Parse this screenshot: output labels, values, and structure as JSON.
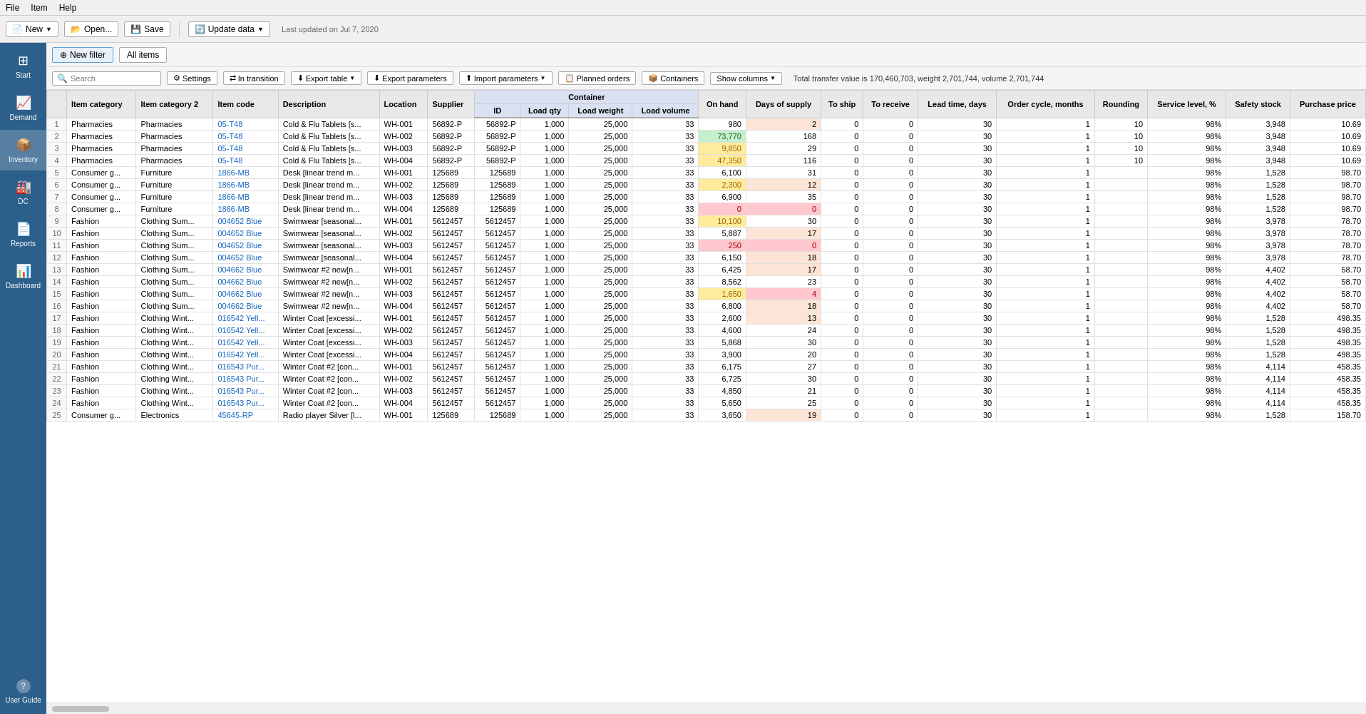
{
  "menu": {
    "items": [
      "File",
      "Item",
      "Help"
    ]
  },
  "toolbar": {
    "new_label": "New",
    "open_label": "Open...",
    "save_label": "Save",
    "update_label": "Update data",
    "last_updated": "Last updated on Jul 7, 2020"
  },
  "sidebar": {
    "items": [
      {
        "id": "start",
        "label": "Start",
        "icon": "⊞"
      },
      {
        "id": "demand",
        "label": "Demand",
        "icon": "📈"
      },
      {
        "id": "inventory",
        "label": "Inventory",
        "icon": "📦"
      },
      {
        "id": "dc",
        "label": "DC",
        "icon": "🏭"
      },
      {
        "id": "reports",
        "label": "Reports",
        "icon": "📄"
      },
      {
        "id": "dashboard",
        "label": "Dashboard",
        "icon": "📊"
      }
    ],
    "bottom": {
      "id": "user-guide",
      "label": "User Guide",
      "icon": "?"
    }
  },
  "filter_bar": {
    "new_filter_label": "New filter",
    "all_items_label": "All items"
  },
  "action_bar": {
    "settings_label": "Settings",
    "in_transition_label": "In transition",
    "export_table_label": "Export table",
    "export_parameters_label": "Export parameters",
    "import_parameters_label": "Import parameters",
    "planned_orders_label": "Planned orders",
    "containers_label": "Containers",
    "show_columns_label": "Show columns",
    "search_placeholder": "Search",
    "total_info": "Total transfer value is 170,460,703, weight 2,701,744, volume 2,701,744"
  },
  "table": {
    "headers": {
      "item_category": "Item category",
      "item_category2": "Item category 2",
      "item_code": "Item code",
      "description": "Description",
      "location": "Location",
      "supplier": "Supplier",
      "container_group": "Container",
      "container_id": "ID",
      "load_qty": "Load qty",
      "load_weight": "Load weight",
      "load_volume": "Load volume",
      "on_hand": "On hand",
      "days_of_supply": "Days of supply",
      "to_ship": "To ship",
      "to_receive": "To receive",
      "lead_time_days": "Lead time, days",
      "order_cycle_months": "Order cycle, months",
      "rounding": "Rounding",
      "service_level": "Service level, %",
      "safety_stock": "Safety stock",
      "purchase_price": "Purchase price"
    },
    "rows": [
      {
        "num": 1,
        "cat1": "Pharmacies",
        "cat2": "Pharmacies",
        "code": "05-T48",
        "desc": "Cold & Flu Tablets [s...",
        "location": "WH-001",
        "supplier": "56892-P",
        "cont_id": "56892-P",
        "load_qty": 1000,
        "load_weight": "25,000",
        "load_volume": 33,
        "on_hand": 980,
        "on_hand_color": "white",
        "days": 2,
        "days_color": "orange",
        "to_ship": 0,
        "to_receive": 0,
        "lead_time": 30,
        "order_cycle": 1,
        "rounding": 10,
        "service_level": "98%",
        "safety_stock": 3948,
        "purchase_price": "10.69"
      },
      {
        "num": 2,
        "cat1": "Pharmacies",
        "cat2": "Pharmacies",
        "code": "05-T48",
        "desc": "Cold & Flu Tablets [s...",
        "location": "WH-002",
        "supplier": "56892-P",
        "cont_id": "56892-P",
        "load_qty": 1000,
        "load_weight": "25,000",
        "load_volume": 33,
        "on_hand": 73770,
        "on_hand_color": "green",
        "days": 168,
        "days_color": "",
        "to_ship": 0,
        "to_receive": 0,
        "lead_time": 30,
        "order_cycle": 1,
        "rounding": 10,
        "service_level": "98%",
        "safety_stock": 3948,
        "purchase_price": "10.69"
      },
      {
        "num": 3,
        "cat1": "Pharmacies",
        "cat2": "Pharmacies",
        "code": "05-T48",
        "desc": "Cold & Flu Tablets [s...",
        "location": "WH-003",
        "supplier": "56892-P",
        "cont_id": "56892-P",
        "load_qty": 1000,
        "load_weight": "25,000",
        "load_volume": 33,
        "on_hand": 9850,
        "on_hand_color": "yellow",
        "days": 29,
        "days_color": "",
        "to_ship": 0,
        "to_receive": 0,
        "lead_time": 30,
        "order_cycle": 1,
        "rounding": 10,
        "service_level": "98%",
        "safety_stock": 3948,
        "purchase_price": "10.69"
      },
      {
        "num": 4,
        "cat1": "Pharmacies",
        "cat2": "Pharmacies",
        "code": "05-T48",
        "desc": "Cold & Flu Tablets [s...",
        "location": "WH-004",
        "supplier": "56892-P",
        "cont_id": "56892-P",
        "load_qty": 1000,
        "load_weight": "25,000",
        "load_volume": 33,
        "on_hand": 47350,
        "on_hand_color": "yellow",
        "days": 116,
        "days_color": "",
        "to_ship": 0,
        "to_receive": 0,
        "lead_time": 30,
        "order_cycle": 1,
        "rounding": 10,
        "service_level": "98%",
        "safety_stock": 3948,
        "purchase_price": "10.69"
      },
      {
        "num": 5,
        "cat1": "Consumer g...",
        "cat2": "Furniture",
        "code": "1866-MB",
        "desc": "Desk [linear trend m...",
        "location": "WH-001",
        "supplier": "125689",
        "cont_id": "125689",
        "load_qty": 1000,
        "load_weight": "25,000",
        "load_volume": 33,
        "on_hand": 6100,
        "on_hand_color": "white",
        "days": 31,
        "days_color": "",
        "to_ship": 0,
        "to_receive": 0,
        "lead_time": 30,
        "order_cycle": 1,
        "rounding": "",
        "service_level": "98%",
        "safety_stock": 1528,
        "purchase_price": "98.70"
      },
      {
        "num": 6,
        "cat1": "Consumer g...",
        "cat2": "Furniture",
        "code": "1866-MB",
        "desc": "Desk [linear trend m...",
        "location": "WH-002",
        "supplier": "125689",
        "cont_id": "125689",
        "load_qty": 1000,
        "load_weight": "25,000",
        "load_volume": 33,
        "on_hand": 2300,
        "on_hand_color": "orange",
        "days": 12,
        "days_color": "orange",
        "to_ship": 0,
        "to_receive": 0,
        "lead_time": 30,
        "order_cycle": 1,
        "rounding": "",
        "service_level": "98%",
        "safety_stock": 1528,
        "purchase_price": "98.70"
      },
      {
        "num": 7,
        "cat1": "Consumer g...",
        "cat2": "Furniture",
        "code": "1866-MB",
        "desc": "Desk [linear trend m...",
        "location": "WH-003",
        "supplier": "125689",
        "cont_id": "125689",
        "load_qty": 1000,
        "load_weight": "25,000",
        "load_volume": 33,
        "on_hand": 6900,
        "on_hand_color": "white",
        "days": 35,
        "days_color": "",
        "to_ship": 0,
        "to_receive": 0,
        "lead_time": 30,
        "order_cycle": 1,
        "rounding": "",
        "service_level": "98%",
        "safety_stock": 1528,
        "purchase_price": "98.70"
      },
      {
        "num": 8,
        "cat1": "Consumer g...",
        "cat2": "Furniture",
        "code": "1866-MB",
        "desc": "Desk [linear trend m...",
        "location": "WH-004",
        "supplier": "125689",
        "cont_id": "125689",
        "load_qty": 1000,
        "load_weight": "25,000",
        "load_volume": 33,
        "on_hand": 0,
        "on_hand_color": "red",
        "days": 0,
        "days_color": "red",
        "to_ship": 0,
        "to_receive": 0,
        "lead_time": 30,
        "order_cycle": 1,
        "rounding": "",
        "service_level": "98%",
        "safety_stock": 1528,
        "purchase_price": "98.70"
      },
      {
        "num": 9,
        "cat1": "Fashion",
        "cat2": "Clothing Sum...",
        "code": "004652 Blue",
        "desc": "Swimwear [seasonal...",
        "location": "WH-001",
        "supplier": "5612457",
        "cont_id": "5612457",
        "load_qty": 1000,
        "load_weight": "25,000",
        "load_volume": 33,
        "on_hand": 10100,
        "on_hand_color": "yellow",
        "days": 30,
        "days_color": "",
        "to_ship": 0,
        "to_receive": 0,
        "lead_time": 30,
        "order_cycle": 1,
        "rounding": "",
        "service_level": "98%",
        "safety_stock": 3978,
        "purchase_price": "78.70"
      },
      {
        "num": 10,
        "cat1": "Fashion",
        "cat2": "Clothing Sum...",
        "code": "004652 Blue",
        "desc": "Swimwear [seasonal...",
        "location": "WH-002",
        "supplier": "5612457",
        "cont_id": "5612457",
        "load_qty": 1000,
        "load_weight": "25,000",
        "load_volume": 33,
        "on_hand": 5887,
        "on_hand_color": "white",
        "days": 17,
        "days_color": "orange",
        "to_ship": 0,
        "to_receive": 0,
        "lead_time": 30,
        "order_cycle": 1,
        "rounding": "",
        "service_level": "98%",
        "safety_stock": 3978,
        "purchase_price": "78.70"
      },
      {
        "num": 11,
        "cat1": "Fashion",
        "cat2": "Clothing Sum...",
        "code": "004652 Blue",
        "desc": "Swimwear [seasonal...",
        "location": "WH-003",
        "supplier": "5612457",
        "cont_id": "5612457",
        "load_qty": 1000,
        "load_weight": "25,000",
        "load_volume": 33,
        "on_hand": 250,
        "on_hand_color": "red",
        "days": 0,
        "days_color": "red",
        "to_ship": 0,
        "to_receive": 0,
        "lead_time": 30,
        "order_cycle": 1,
        "rounding": "",
        "service_level": "98%",
        "safety_stock": 3978,
        "purchase_price": "78.70"
      },
      {
        "num": 12,
        "cat1": "Fashion",
        "cat2": "Clothing Sum...",
        "code": "004652 Blue",
        "desc": "Swimwear [seasonal...",
        "location": "WH-004",
        "supplier": "5612457",
        "cont_id": "5612457",
        "load_qty": 1000,
        "load_weight": "25,000",
        "load_volume": 33,
        "on_hand": 6150,
        "on_hand_color": "white",
        "days": 18,
        "days_color": "orange",
        "to_ship": 0,
        "to_receive": 0,
        "lead_time": 30,
        "order_cycle": 1,
        "rounding": "",
        "service_level": "98%",
        "safety_stock": 3978,
        "purchase_price": "78.70"
      },
      {
        "num": 13,
        "cat1": "Fashion",
        "cat2": "Clothing Sum...",
        "code": "004662 Blue",
        "desc": "Swimwear #2 new[n...",
        "location": "WH-001",
        "supplier": "5612457",
        "cont_id": "5612457",
        "load_qty": 1000,
        "load_weight": "25,000",
        "load_volume": 33,
        "on_hand": 6425,
        "on_hand_color": "white",
        "days": 17,
        "days_color": "orange",
        "to_ship": 0,
        "to_receive": 0,
        "lead_time": 30,
        "order_cycle": 1,
        "rounding": "",
        "service_level": "98%",
        "safety_stock": 4402,
        "purchase_price": "58.70"
      },
      {
        "num": 14,
        "cat1": "Fashion",
        "cat2": "Clothing Sum...",
        "code": "004662 Blue",
        "desc": "Swimwear #2 new[n...",
        "location": "WH-002",
        "supplier": "5612457",
        "cont_id": "5612457",
        "load_qty": 1000,
        "load_weight": "25,000",
        "load_volume": 33,
        "on_hand": 8562,
        "on_hand_color": "white",
        "days": 23,
        "days_color": "",
        "to_ship": 0,
        "to_receive": 0,
        "lead_time": 30,
        "order_cycle": 1,
        "rounding": "",
        "service_level": "98%",
        "safety_stock": 4402,
        "purchase_price": "58.70"
      },
      {
        "num": 15,
        "cat1": "Fashion",
        "cat2": "Clothing Sum...",
        "code": "004662 Blue",
        "desc": "Swimwear #2 new[n...",
        "location": "WH-003",
        "supplier": "5612457",
        "cont_id": "5612457",
        "load_qty": 1000,
        "load_weight": "25,000",
        "load_volume": 33,
        "on_hand": 1650,
        "on_hand_color": "orange",
        "days": 4,
        "days_color": "red",
        "to_ship": 0,
        "to_receive": 0,
        "lead_time": 30,
        "order_cycle": 1,
        "rounding": "",
        "service_level": "98%",
        "safety_stock": 4402,
        "purchase_price": "58.70"
      },
      {
        "num": 16,
        "cat1": "Fashion",
        "cat2": "Clothing Sum...",
        "code": "004662 Blue",
        "desc": "Swimwear #2 new[n...",
        "location": "WH-004",
        "supplier": "5612457",
        "cont_id": "5612457",
        "load_qty": 1000,
        "load_weight": "25,000",
        "load_volume": 33,
        "on_hand": 6800,
        "on_hand_color": "white",
        "days": 18,
        "days_color": "orange",
        "to_ship": 0,
        "to_receive": 0,
        "lead_time": 30,
        "order_cycle": 1,
        "rounding": "",
        "service_level": "98%",
        "safety_stock": 4402,
        "purchase_price": "58.70"
      },
      {
        "num": 17,
        "cat1": "Fashion",
        "cat2": "Clothing Wint...",
        "code": "016542 Yell...",
        "desc": "Winter Coat [excessi...",
        "location": "WH-001",
        "supplier": "5612457",
        "cont_id": "5612457",
        "load_qty": 1000,
        "load_weight": "25,000",
        "load_volume": 33,
        "on_hand": 2600,
        "on_hand_color": "white",
        "days": 13,
        "days_color": "orange",
        "to_ship": 0,
        "to_receive": 0,
        "lead_time": 30,
        "order_cycle": 1,
        "rounding": "",
        "service_level": "98%",
        "safety_stock": 1528,
        "purchase_price": "498.35"
      },
      {
        "num": 18,
        "cat1": "Fashion",
        "cat2": "Clothing Wint...",
        "code": "016542 Yell...",
        "desc": "Winter Coat [excessi...",
        "location": "WH-002",
        "supplier": "5612457",
        "cont_id": "5612457",
        "load_qty": 1000,
        "load_weight": "25,000",
        "load_volume": 33,
        "on_hand": 4600,
        "on_hand_color": "white",
        "days": 24,
        "days_color": "",
        "to_ship": 0,
        "to_receive": 0,
        "lead_time": 30,
        "order_cycle": 1,
        "rounding": "",
        "service_level": "98%",
        "safety_stock": 1528,
        "purchase_price": "498.35"
      },
      {
        "num": 19,
        "cat1": "Fashion",
        "cat2": "Clothing Wint...",
        "code": "016542 Yell...",
        "desc": "Winter Coat [excessi...",
        "location": "WH-003",
        "supplier": "5612457",
        "cont_id": "5612457",
        "load_qty": 1000,
        "load_weight": "25,000",
        "load_volume": 33,
        "on_hand": 5868,
        "on_hand_color": "white",
        "days": 30,
        "days_color": "",
        "to_ship": 0,
        "to_receive": 0,
        "lead_time": 30,
        "order_cycle": 1,
        "rounding": "",
        "service_level": "98%",
        "safety_stock": 1528,
        "purchase_price": "498.35"
      },
      {
        "num": 20,
        "cat1": "Fashion",
        "cat2": "Clothing Wint...",
        "code": "016542 Yell...",
        "desc": "Winter Coat [excessi...",
        "location": "WH-004",
        "supplier": "5612457",
        "cont_id": "5612457",
        "load_qty": 1000,
        "load_weight": "25,000",
        "load_volume": 33,
        "on_hand": 3900,
        "on_hand_color": "white",
        "days": 20,
        "days_color": "",
        "to_ship": 0,
        "to_receive": 0,
        "lead_time": 30,
        "order_cycle": 1,
        "rounding": "",
        "service_level": "98%",
        "safety_stock": 1528,
        "purchase_price": "498.35"
      },
      {
        "num": 21,
        "cat1": "Fashion",
        "cat2": "Clothing Wint...",
        "code": "016543 Pur...",
        "desc": "Winter Coat #2 [con...",
        "location": "WH-001",
        "supplier": "5612457",
        "cont_id": "5612457",
        "load_qty": 1000,
        "load_weight": "25,000",
        "load_volume": 33,
        "on_hand": 6175,
        "on_hand_color": "white",
        "days": 27,
        "days_color": "",
        "to_ship": 0,
        "to_receive": 0,
        "lead_time": 30,
        "order_cycle": 1,
        "rounding": "",
        "service_level": "98%",
        "safety_stock": 4114,
        "purchase_price": "458.35"
      },
      {
        "num": 22,
        "cat1": "Fashion",
        "cat2": "Clothing Wint...",
        "code": "016543 Pur...",
        "desc": "Winter Coat #2 [con...",
        "location": "WH-002",
        "supplier": "5612457",
        "cont_id": "5612457",
        "load_qty": 1000,
        "load_weight": "25,000",
        "load_volume": 33,
        "on_hand": 6725,
        "on_hand_color": "white",
        "days": 30,
        "days_color": "",
        "to_ship": 0,
        "to_receive": 0,
        "lead_time": 30,
        "order_cycle": 1,
        "rounding": "",
        "service_level": "98%",
        "safety_stock": 4114,
        "purchase_price": "458.35"
      },
      {
        "num": 23,
        "cat1": "Fashion",
        "cat2": "Clothing Wint...",
        "code": "016543 Pur...",
        "desc": "Winter Coat #2 [con...",
        "location": "WH-003",
        "supplier": "5612457",
        "cont_id": "5612457",
        "load_qty": 1000,
        "load_weight": "25,000",
        "load_volume": 33,
        "on_hand": 4850,
        "on_hand_color": "white",
        "days": 21,
        "days_color": "",
        "to_ship": 0,
        "to_receive": 0,
        "lead_time": 30,
        "order_cycle": 1,
        "rounding": "",
        "service_level": "98%",
        "safety_stock": 4114,
        "purchase_price": "458.35"
      },
      {
        "num": 24,
        "cat1": "Fashion",
        "cat2": "Clothing Wint...",
        "code": "016543 Pur...",
        "desc": "Winter Coat #2 [con...",
        "location": "WH-004",
        "supplier": "5612457",
        "cont_id": "5612457",
        "load_qty": 1000,
        "load_weight": "25,000",
        "load_volume": 33,
        "on_hand": 5650,
        "on_hand_color": "white",
        "days": 25,
        "days_color": "",
        "to_ship": 0,
        "to_receive": 0,
        "lead_time": 30,
        "order_cycle": 1,
        "rounding": "",
        "service_level": "98%",
        "safety_stock": 4114,
        "purchase_price": "458.35"
      },
      {
        "num": 25,
        "cat1": "Consumer g...",
        "cat2": "Electronics",
        "code": "45645-RP",
        "desc": "Radio player Silver [l...",
        "location": "WH-001",
        "supplier": "125689",
        "cont_id": "125689",
        "load_qty": 1000,
        "load_weight": "25,000",
        "load_volume": 33,
        "on_hand": 3650,
        "on_hand_color": "white",
        "days": 19,
        "days_color": "orange",
        "to_ship": 0,
        "to_receive": 0,
        "lead_time": 30,
        "order_cycle": 1,
        "rounding": "",
        "service_level": "98%",
        "safety_stock": 1528,
        "purchase_price": "158.70"
      }
    ]
  }
}
